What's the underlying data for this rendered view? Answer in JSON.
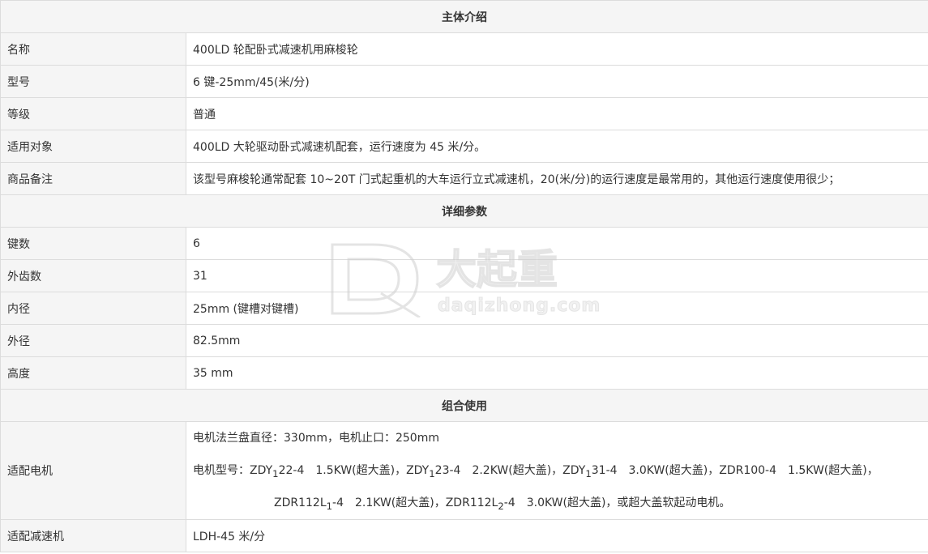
{
  "section1": {
    "title": "主体介绍",
    "rows": [
      {
        "label": "名称",
        "value": "400LD 轮配卧式减速机用麻梭轮"
      },
      {
        "label": "型号",
        "value": "6 键-25mm/45(米/分)"
      },
      {
        "label": "等级",
        "value": "普通"
      },
      {
        "label": "适用对象",
        "value": "400LD 大轮驱动卧式减速机配套，运行速度为 45 米/分。"
      },
      {
        "label": "商品备注",
        "value": "该型号麻梭轮通常配套 10~20T 门式起重机的大车运行立式减速机，20(米/分)的运行速度是最常用的，其他运行速度使用很少；"
      }
    ]
  },
  "section2": {
    "title": "详细参数",
    "rows": [
      {
        "label": "键数",
        "value": "6"
      },
      {
        "label": "外齿数",
        "value": "31"
      },
      {
        "label": "内径",
        "value": "25mm (键槽对键槽)"
      },
      {
        "label": "外径",
        "value": "82.5mm"
      },
      {
        "label": "高度",
        "value": "35 mm"
      }
    ]
  },
  "section3": {
    "title": "组合使用",
    "motor": {
      "label": "适配电机",
      "line1": "电机法兰盘直径：330mm，电机止口：250mm",
      "line2_parts": [
        "电机型号：ZDY",
        "1",
        "22-4　1.5KW(超大盖)，ZDY",
        "1",
        "23-4　2.2KW(超大盖)，ZDY",
        "1",
        "31-4　3.0KW(超大盖)，ZDR100-4　1.5KW(超大盖)，"
      ],
      "line3_parts": [
        "ZDR112L",
        "1",
        "-4　2.1KW(超大盖)，ZDR112L",
        "2",
        "-4　3.0KW(超大盖)，或超大盖软起动电机。"
      ]
    },
    "reducer": {
      "label": "适配减速机",
      "value": "LDH-45 米/分"
    }
  },
  "watermark": {
    "brand": "大起重",
    "domain": "daqizhong.com",
    "logo_letter": "DQ"
  }
}
